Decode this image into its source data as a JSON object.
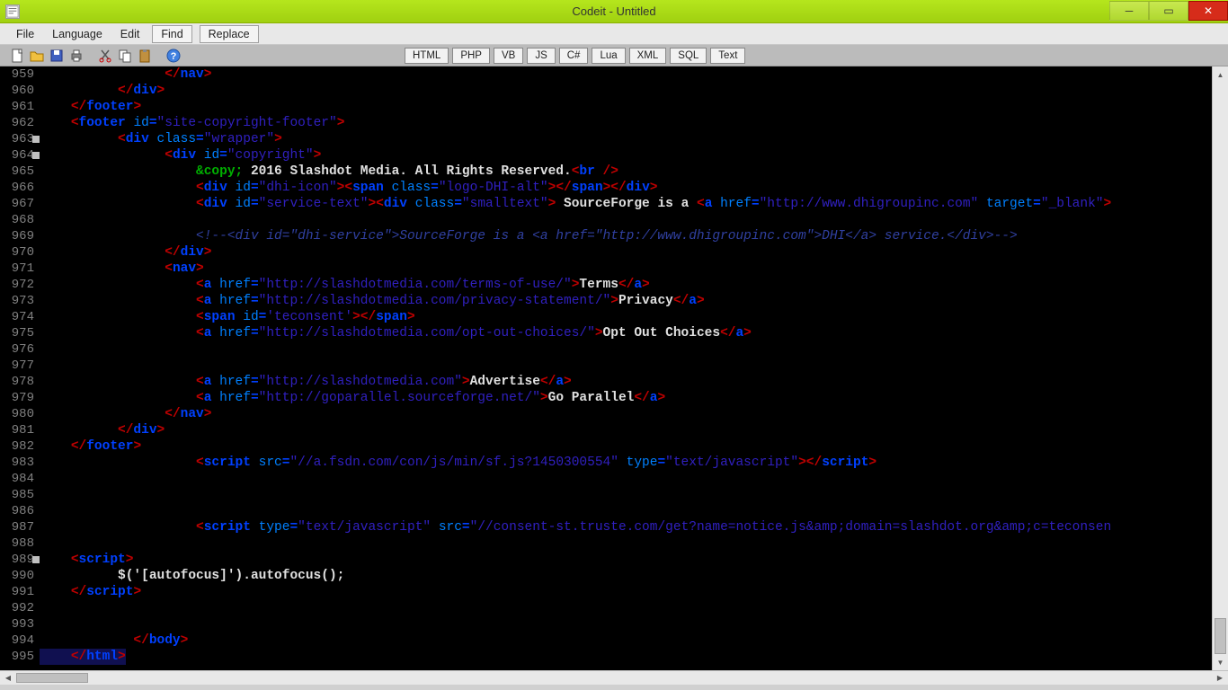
{
  "title": "Codeit - Untitled",
  "menu": {
    "file": "File",
    "language": "Language",
    "edit": "Edit",
    "find": "Find",
    "replace": "Replace"
  },
  "lang_buttons": [
    "HTML",
    "PHP",
    "VB",
    "JS",
    "C#",
    "Lua",
    "XML",
    "SQL",
    "Text"
  ],
  "lines": [
    {
      "n": 959,
      "seg": [
        [
          "",
          16
        ],
        [
          "t-tag",
          "</"
        ],
        [
          "t-attr",
          "nav"
        ],
        [
          "t-tag",
          ">"
        ]
      ]
    },
    {
      "n": 960,
      "seg": [
        [
          "",
          10
        ],
        [
          "t-tag",
          "</"
        ],
        [
          "t-attr",
          "div"
        ],
        [
          "t-tag",
          ">"
        ]
      ]
    },
    {
      "n": 961,
      "seg": [
        [
          "",
          4
        ],
        [
          "t-tag",
          "</"
        ],
        [
          "t-attr",
          "footer"
        ],
        [
          "t-tag",
          ">"
        ]
      ]
    },
    {
      "n": 962,
      "seg": [
        [
          "",
          4
        ],
        [
          "t-tag",
          "<"
        ],
        [
          "t-attr",
          "footer "
        ],
        [
          "t-val",
          "id"
        ],
        [
          "t-attr",
          "="
        ],
        [
          "t-str",
          "\"site-copyright-footer\""
        ],
        [
          "t-tag",
          ">"
        ]
      ]
    },
    {
      "n": 963,
      "fold": true,
      "seg": [
        [
          "",
          10
        ],
        [
          "t-tag",
          "<"
        ],
        [
          "t-attr",
          "div "
        ],
        [
          "t-val",
          "class"
        ],
        [
          "t-attr",
          "="
        ],
        [
          "t-str",
          "\"wrapper\""
        ],
        [
          "t-tag",
          ">"
        ]
      ]
    },
    {
      "n": 964,
      "fold": true,
      "seg": [
        [
          "",
          16
        ],
        [
          "t-tag",
          "<"
        ],
        [
          "t-attr",
          "div "
        ],
        [
          "t-val",
          "id"
        ],
        [
          "t-attr",
          "="
        ],
        [
          "t-str",
          "\"copyright\""
        ],
        [
          "t-tag",
          ">"
        ]
      ]
    },
    {
      "n": 965,
      "seg": [
        [
          "",
          20
        ],
        [
          "t-ent",
          "&copy;"
        ],
        [
          "t-txt",
          " 2016 Slashdot Media. All Rights Reserved."
        ],
        [
          "t-tag",
          "<"
        ],
        [
          "t-attr",
          "br "
        ],
        [
          "t-tag",
          "/>"
        ]
      ]
    },
    {
      "n": 966,
      "seg": [
        [
          "",
          20
        ],
        [
          "t-tag",
          "<"
        ],
        [
          "t-attr",
          "div "
        ],
        [
          "t-val",
          "id"
        ],
        [
          "t-attr",
          "="
        ],
        [
          "t-str",
          "\"dhi-icon\""
        ],
        [
          "t-tag",
          "><"
        ],
        [
          "t-attr",
          "span "
        ],
        [
          "t-val",
          "class"
        ],
        [
          "t-attr",
          "="
        ],
        [
          "t-str",
          "\"logo-DHI-alt\""
        ],
        [
          "t-tag",
          "></"
        ],
        [
          "t-attr",
          "span"
        ],
        [
          "t-tag",
          "></"
        ],
        [
          "t-attr",
          "div"
        ],
        [
          "t-tag",
          ">"
        ]
      ]
    },
    {
      "n": 967,
      "seg": [
        [
          "",
          20
        ],
        [
          "t-tag",
          "<"
        ],
        [
          "t-attr",
          "div "
        ],
        [
          "t-val",
          "id"
        ],
        [
          "t-attr",
          "="
        ],
        [
          "t-str",
          "\"service-text\""
        ],
        [
          "t-tag",
          "><"
        ],
        [
          "t-attr",
          "div "
        ],
        [
          "t-val",
          "class"
        ],
        [
          "t-attr",
          "="
        ],
        [
          "t-str",
          "\"smalltext\""
        ],
        [
          "t-tag",
          ">"
        ],
        [
          "t-txt",
          " SourceForge is a "
        ],
        [
          "t-tag",
          "<"
        ],
        [
          "t-attr",
          "a "
        ],
        [
          "t-val",
          "href"
        ],
        [
          "t-attr",
          "="
        ],
        [
          "t-str",
          "\"http://www.dhigroupinc.com\""
        ],
        [
          "t-attr",
          " "
        ],
        [
          "t-val",
          "target"
        ],
        [
          "t-attr",
          "="
        ],
        [
          "t-str",
          "\"_blank\""
        ],
        [
          "t-tag",
          ">"
        ]
      ]
    },
    {
      "n": 968,
      "seg": []
    },
    {
      "n": 969,
      "seg": [
        [
          "",
          20
        ],
        [
          "t-com",
          "<!--<div id=\"dhi-service\">SourceForge is a <a href=\"http://www.dhigroupinc.com\">DHI</a> service.</div>-->"
        ]
      ]
    },
    {
      "n": 970,
      "seg": [
        [
          "",
          16
        ],
        [
          "t-tag",
          "</"
        ],
        [
          "t-attr",
          "div"
        ],
        [
          "t-tag",
          ">"
        ]
      ]
    },
    {
      "n": 971,
      "seg": [
        [
          "",
          16
        ],
        [
          "t-tag",
          "<"
        ],
        [
          "t-attr",
          "nav"
        ],
        [
          "t-tag",
          ">"
        ]
      ]
    },
    {
      "n": 972,
      "seg": [
        [
          "",
          20
        ],
        [
          "t-tag",
          "<"
        ],
        [
          "t-attr",
          "a "
        ],
        [
          "t-val",
          "href"
        ],
        [
          "t-attr",
          "="
        ],
        [
          "t-str",
          "\"http://slashdotmedia.com/terms-of-use/\""
        ],
        [
          "t-tag",
          ">"
        ],
        [
          "t-txt",
          "Terms"
        ],
        [
          "t-tag",
          "</"
        ],
        [
          "t-attr",
          "a"
        ],
        [
          "t-tag",
          ">"
        ]
      ]
    },
    {
      "n": 973,
      "seg": [
        [
          "",
          20
        ],
        [
          "t-tag",
          "<"
        ],
        [
          "t-attr",
          "a "
        ],
        [
          "t-val",
          "href"
        ],
        [
          "t-attr",
          "="
        ],
        [
          "t-str",
          "\"http://slashdotmedia.com/privacy-statement/\""
        ],
        [
          "t-tag",
          ">"
        ],
        [
          "t-txt",
          "Privacy"
        ],
        [
          "t-tag",
          "</"
        ],
        [
          "t-attr",
          "a"
        ],
        [
          "t-tag",
          ">"
        ]
      ]
    },
    {
      "n": 974,
      "seg": [
        [
          "",
          20
        ],
        [
          "t-tag",
          "<"
        ],
        [
          "t-attr",
          "span "
        ],
        [
          "t-val",
          "id"
        ],
        [
          "t-attr",
          "="
        ],
        [
          "t-str",
          "'teconsent'"
        ],
        [
          "t-tag",
          "></"
        ],
        [
          "t-attr",
          "span"
        ],
        [
          "t-tag",
          ">"
        ]
      ]
    },
    {
      "n": 975,
      "seg": [
        [
          "",
          20
        ],
        [
          "t-tag",
          "<"
        ],
        [
          "t-attr",
          "a "
        ],
        [
          "t-val",
          "href"
        ],
        [
          "t-attr",
          "="
        ],
        [
          "t-str",
          "\"http://slashdotmedia.com/opt-out-choices/\""
        ],
        [
          "t-tag",
          ">"
        ],
        [
          "t-txt",
          "Opt Out Choices"
        ],
        [
          "t-tag",
          "</"
        ],
        [
          "t-attr",
          "a"
        ],
        [
          "t-tag",
          ">"
        ]
      ]
    },
    {
      "n": 976,
      "seg": []
    },
    {
      "n": 977,
      "seg": []
    },
    {
      "n": 978,
      "seg": [
        [
          "",
          20
        ],
        [
          "t-tag",
          "<"
        ],
        [
          "t-attr",
          "a "
        ],
        [
          "t-val",
          "href"
        ],
        [
          "t-attr",
          "="
        ],
        [
          "t-str",
          "\"http://slashdotmedia.com\""
        ],
        [
          "t-tag",
          ">"
        ],
        [
          "t-txt",
          "Advertise"
        ],
        [
          "t-tag",
          "</"
        ],
        [
          "t-attr",
          "a"
        ],
        [
          "t-tag",
          ">"
        ]
      ]
    },
    {
      "n": 979,
      "seg": [
        [
          "",
          20
        ],
        [
          "t-tag",
          "<"
        ],
        [
          "t-attr",
          "a "
        ],
        [
          "t-val",
          "href"
        ],
        [
          "t-attr",
          "="
        ],
        [
          "t-str",
          "\"http://goparallel.sourceforge.net/\""
        ],
        [
          "t-tag",
          ">"
        ],
        [
          "t-txt",
          "Go Parallel"
        ],
        [
          "t-tag",
          "</"
        ],
        [
          "t-attr",
          "a"
        ],
        [
          "t-tag",
          ">"
        ]
      ]
    },
    {
      "n": 980,
      "seg": [
        [
          "",
          16
        ],
        [
          "t-tag",
          "</"
        ],
        [
          "t-attr",
          "nav"
        ],
        [
          "t-tag",
          ">"
        ]
      ]
    },
    {
      "n": 981,
      "seg": [
        [
          "",
          10
        ],
        [
          "t-tag",
          "</"
        ],
        [
          "t-attr",
          "div"
        ],
        [
          "t-tag",
          ">"
        ]
      ]
    },
    {
      "n": 982,
      "seg": [
        [
          "",
          4
        ],
        [
          "t-tag",
          "</"
        ],
        [
          "t-attr",
          "footer"
        ],
        [
          "t-tag",
          ">"
        ]
      ]
    },
    {
      "n": 983,
      "seg": [
        [
          "",
          20
        ],
        [
          "t-tag",
          "<"
        ],
        [
          "t-attr",
          "script "
        ],
        [
          "t-val",
          "src"
        ],
        [
          "t-attr",
          "="
        ],
        [
          "t-str",
          "\"//a.fsdn.com/con/js/min/sf.js?1450300554\""
        ],
        [
          "t-attr",
          " "
        ],
        [
          "t-val",
          "type"
        ],
        [
          "t-attr",
          "="
        ],
        [
          "t-str",
          "\"text/javascript\""
        ],
        [
          "t-tag",
          "></"
        ],
        [
          "t-attr",
          "script"
        ],
        [
          "t-tag",
          ">"
        ]
      ]
    },
    {
      "n": 984,
      "seg": []
    },
    {
      "n": 985,
      "seg": []
    },
    {
      "n": 986,
      "seg": []
    },
    {
      "n": 987,
      "seg": [
        [
          "",
          20
        ],
        [
          "t-tag",
          "<"
        ],
        [
          "t-attr",
          "script "
        ],
        [
          "t-val",
          "type"
        ],
        [
          "t-attr",
          "="
        ],
        [
          "t-str",
          "\"text/javascript\""
        ],
        [
          "t-attr",
          " "
        ],
        [
          "t-val",
          "src"
        ],
        [
          "t-attr",
          "="
        ],
        [
          "t-str",
          "\"//consent-st.truste.com/get?name=notice.js&amp;domain=slashdot.org&amp;c=teconsen"
        ]
      ]
    },
    {
      "n": 988,
      "seg": []
    },
    {
      "n": 989,
      "fold": true,
      "seg": [
        [
          "",
          4
        ],
        [
          "t-tag",
          "<"
        ],
        [
          "t-attr",
          "script"
        ],
        [
          "t-tag",
          ">"
        ]
      ]
    },
    {
      "n": 990,
      "seg": [
        [
          "",
          10
        ],
        [
          "t-txt",
          "$('[autofocus]').autofocus();"
        ]
      ]
    },
    {
      "n": 991,
      "seg": [
        [
          "",
          4
        ],
        [
          "t-tag",
          "</"
        ],
        [
          "t-attr",
          "script"
        ],
        [
          "t-tag",
          ">"
        ]
      ]
    },
    {
      "n": 992,
      "seg": []
    },
    {
      "n": 993,
      "seg": []
    },
    {
      "n": 994,
      "seg": [
        [
          "",
          12
        ],
        [
          "t-tag",
          "</"
        ],
        [
          "t-attr",
          "body"
        ],
        [
          "t-tag",
          ">"
        ]
      ]
    },
    {
      "n": 995,
      "sel": true,
      "seg": [
        [
          "",
          4
        ],
        [
          "t-tag",
          "</"
        ],
        [
          "t-attr",
          "html"
        ],
        [
          "t-tag",
          ">"
        ]
      ]
    }
  ]
}
